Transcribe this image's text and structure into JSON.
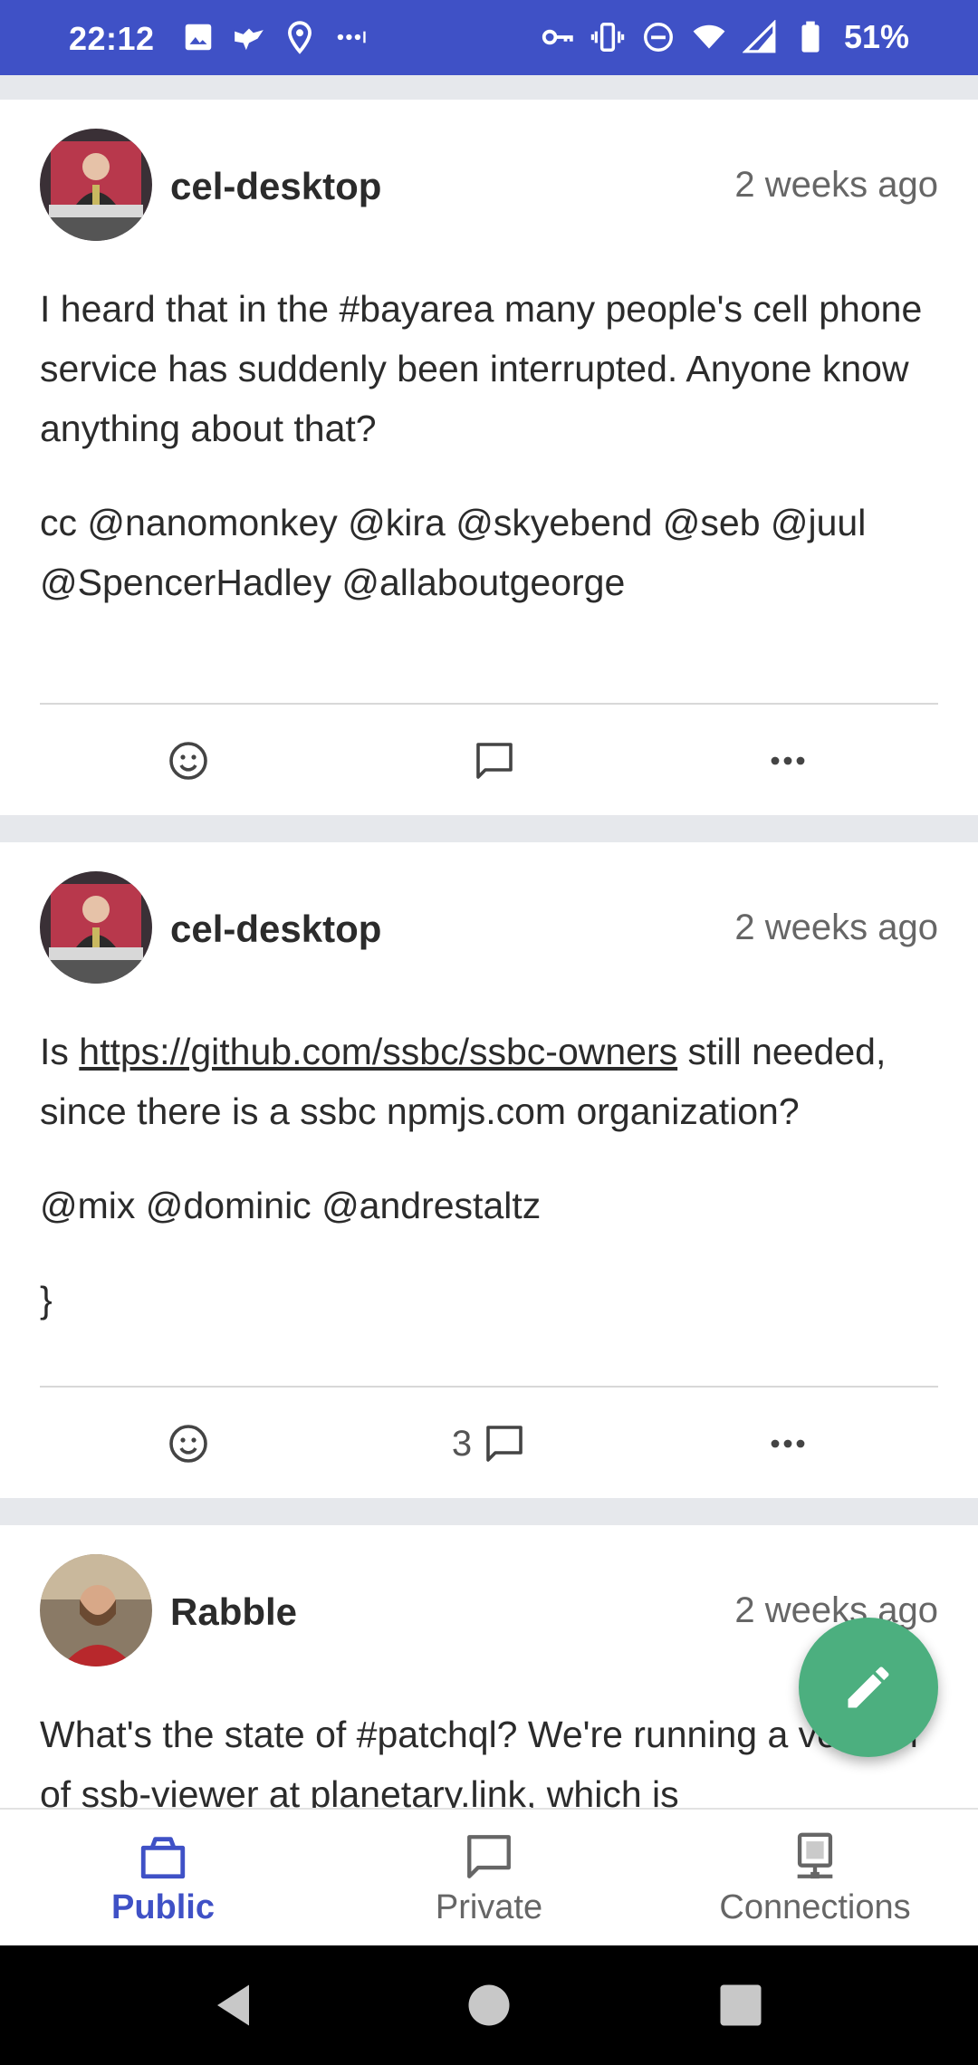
{
  "status_bar": {
    "time": "22:12",
    "battery": "51%",
    "icons": [
      "image-icon",
      "bird-icon",
      "location-icon",
      "more-dots-icon",
      "vpn-key-icon",
      "vibrate-icon",
      "dnd-icon",
      "wifi-icon",
      "signal-icon",
      "battery-icon"
    ]
  },
  "posts": [
    {
      "author": "cel-desktop",
      "time": "2 weeks ago",
      "paragraphs": [
        "I heard that in the #bayarea many people's cell phone service has suddenly been interrupted. Anyone know anything about that?",
        "cc @nanomonkey @kira @skyebend @seb @juul @SpencerHadley @allaboutgeorge"
      ],
      "reply_count": ""
    },
    {
      "author": "cel-desktop",
      "time": "2 weeks ago",
      "text_before_link": "Is ",
      "link": "https://github.com/ssbc/ssbc-owners",
      "text_after_link": " still needed, since there is a ssbc npmjs.com organization?",
      "paragraph2": "@mix @dominic @andrestaltz",
      "reply_count": "3"
    },
    {
      "author": "Rabble",
      "time": "2 weeks ago",
      "paragraph": "What's the state of #patchql? We're running a version of ssb-viewer at planetary.link, which is"
    }
  ],
  "bottom_nav": {
    "tabs": [
      {
        "label": "Public",
        "active": true
      },
      {
        "label": "Private",
        "active": false
      },
      {
        "label": "Connections",
        "active": false
      }
    ]
  },
  "colors": {
    "accent": "#3f51c6",
    "fab": "#4caf7f",
    "background": "#e6e8ec"
  }
}
